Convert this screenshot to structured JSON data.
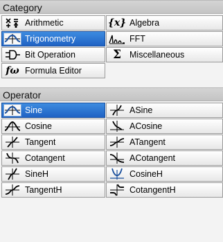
{
  "category": {
    "title": "Category",
    "items": [
      {
        "label": "Arithmetic",
        "icon": "arithmetic-icon"
      },
      {
        "label": "Algebra",
        "icon": "algebra-icon"
      },
      {
        "label": "Trigonometry",
        "icon": "trigonometry-icon",
        "selected": true
      },
      {
        "label": "FFT",
        "icon": "fft-icon"
      },
      {
        "label": "Bit Operation",
        "icon": "bit-operation-icon"
      },
      {
        "label": "Miscellaneous",
        "icon": "sigma-icon"
      },
      {
        "label": "Formula Editor",
        "icon": "formula-icon"
      }
    ]
  },
  "operator": {
    "title": "Operator",
    "items": [
      {
        "label": "Sine",
        "icon": "sine-icon",
        "selected": true
      },
      {
        "label": "ASine",
        "icon": "asine-icon"
      },
      {
        "label": "Cosine",
        "icon": "cosine-icon"
      },
      {
        "label": "ACosine",
        "icon": "acosine-icon"
      },
      {
        "label": "Tangent",
        "icon": "tangent-icon"
      },
      {
        "label": "ATangent",
        "icon": "atangent-icon"
      },
      {
        "label": "Cotangent",
        "icon": "cotangent-icon"
      },
      {
        "label": "ACotangent",
        "icon": "acotangent-icon"
      },
      {
        "label": "SineH",
        "icon": "sineh-icon"
      },
      {
        "label": "CosineH",
        "icon": "cosineh-icon"
      },
      {
        "label": "TangentH",
        "icon": "tangenth-icon"
      },
      {
        "label": "CotangentH",
        "icon": "cotangenth-icon"
      }
    ]
  },
  "colors": {
    "selected": "#2f74d6",
    "curve": "#000000",
    "accent_blue": "#1a4f9c"
  }
}
